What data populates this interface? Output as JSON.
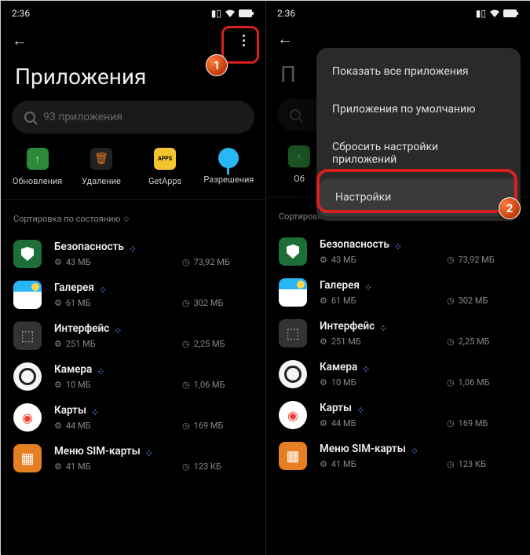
{
  "status": {
    "time": "2:36"
  },
  "header": {
    "title": "Приложения"
  },
  "search": {
    "placeholder": "93 приложения"
  },
  "actions": [
    {
      "label": "Обновления"
    },
    {
      "label": "Удаление"
    },
    {
      "label": "GetApps"
    },
    {
      "label": "Разрешения"
    }
  ],
  "sort": {
    "label": "Сортировка по состоянию"
  },
  "apps": [
    {
      "name": "Безопасность",
      "size": "43 МБ",
      "storage": "73,92 МБ"
    },
    {
      "name": "Галерея",
      "size": "61 МБ",
      "storage": "302 МБ"
    },
    {
      "name": "Интерфейс",
      "size": "251 МБ",
      "storage": "2,25 МБ"
    },
    {
      "name": "Камера",
      "size": "10 МБ",
      "storage": "1,06 МБ"
    },
    {
      "name": "Карты",
      "size": "44 МБ",
      "storage": "169 МБ"
    },
    {
      "name": "Меню SIM-карты",
      "size": "41 МБ",
      "storage": "123 КБ"
    }
  ],
  "menu": {
    "items": [
      "Показать все приложения",
      "Приложения по умолчанию",
      "Сбросить настройки приложений",
      "Настройки"
    ]
  },
  "action_partial": "Об",
  "callouts": {
    "1": "1",
    "2": "2"
  }
}
